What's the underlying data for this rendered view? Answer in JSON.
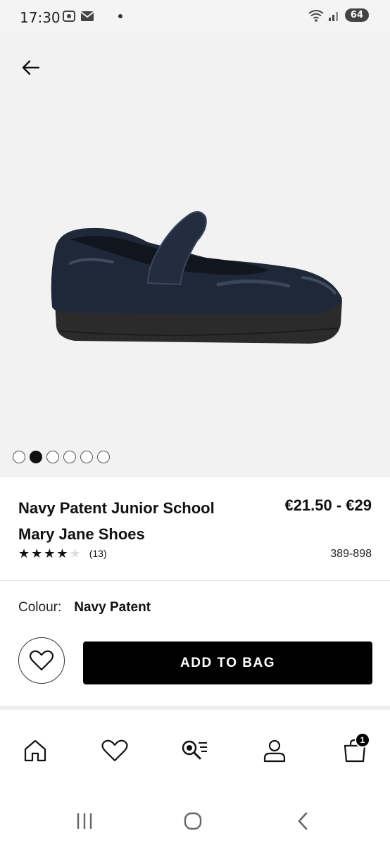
{
  "status_bar": {
    "time": "17:30",
    "battery": "64"
  },
  "product": {
    "title": "Navy Patent Junior School Mary Jane Shoes",
    "price": "€21.50 - €29",
    "rating_stars": 4,
    "rating_max": 5,
    "rating_count": "(13)",
    "code": "389-898",
    "colour_label": "Colour:",
    "colour_value": "Navy Patent"
  },
  "gallery": {
    "total_images": 6,
    "active_index": 1
  },
  "actions": {
    "add_to_bag_label": "ADD TO BAG"
  },
  "bottom_nav": {
    "items": [
      "home-icon",
      "heart-icon",
      "search-icon",
      "account-icon",
      "bag-icon"
    ],
    "bag_count": "1"
  },
  "colors": {
    "hero_bg": "#f2f2f2",
    "button_bg": "#000000",
    "shoe": "#1f2838",
    "sole": "#2b2b2b"
  }
}
